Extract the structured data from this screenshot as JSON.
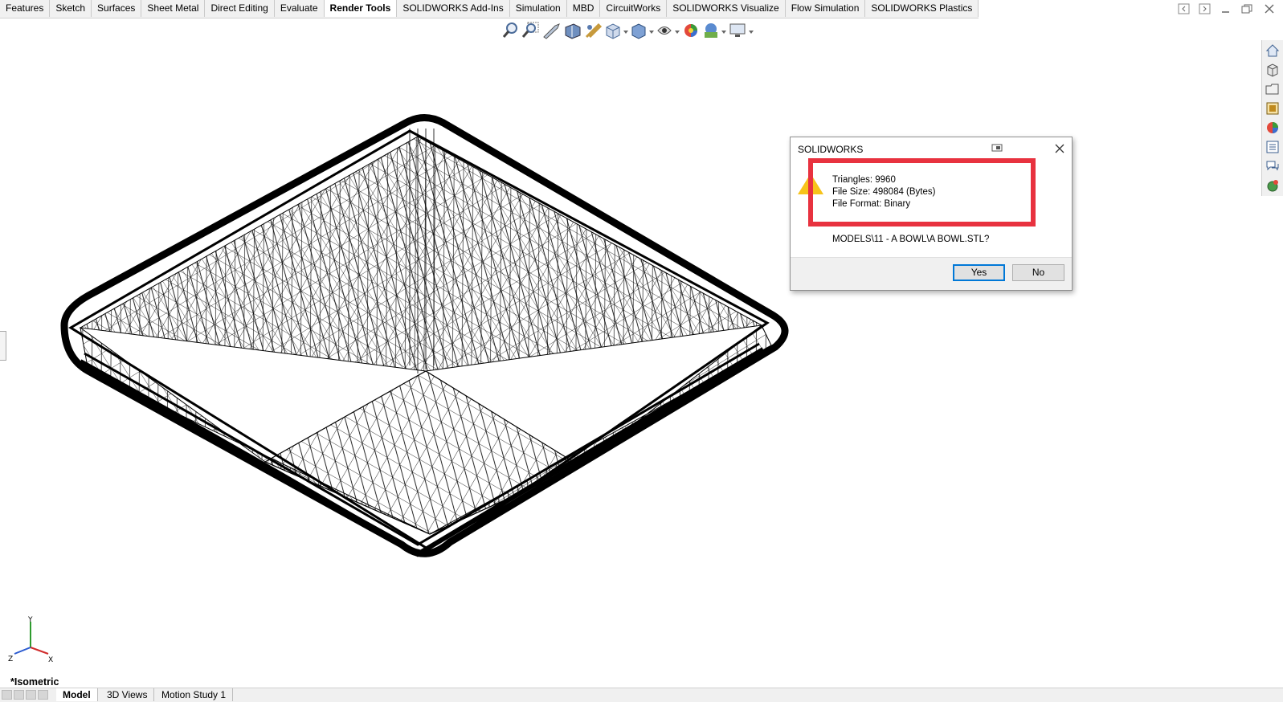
{
  "tabs": [
    "Features",
    "Sketch",
    "Surfaces",
    "Sheet Metal",
    "Direct Editing",
    "Evaluate",
    "Render Tools",
    "SOLIDWORKS Add-Ins",
    "Simulation",
    "MBD",
    "CircuitWorks",
    "SOLIDWORKS Visualize",
    "Flow Simulation",
    "SOLIDWORKS Plastics"
  ],
  "active_tab": "Render Tools",
  "hud_icons": [
    "zoom-to-fit-icon",
    "zoom-to-area-icon",
    "previous-view-icon",
    "section-view-icon",
    "dynamic-annotation-icon",
    "view-orientation-icon",
    "display-style-icon",
    "hide-show-items-icon",
    "edit-appearance-icon",
    "apply-scene-icon",
    "view-settings-icon"
  ],
  "taskpane_icons": [
    "home-icon",
    "design-library-icon",
    "file-explorer-icon",
    "view-palette-icon",
    "appearances-icon",
    "custom-properties-icon",
    "forum-icon",
    "resources-icon"
  ],
  "dialog": {
    "title": "SOLIDWORKS",
    "triangles": "Triangles: 9960",
    "file_size": "File Size: 498084 (Bytes)",
    "file_format": "File Format: Binary",
    "path_text": "MODELS\\11 - A BOWL\\A BOWL.STL?",
    "yes_label": "Yes",
    "no_label": "No"
  },
  "view_name": "*Isometric",
  "triad": {
    "x_label": "X",
    "y_label": "Y",
    "z_label": "Z"
  },
  "bottom_tabs": [
    "Model",
    "3D Views",
    "Motion Study 1"
  ],
  "active_bottom_tab": "Model",
  "colors": {
    "highlight": "#e8323f",
    "default_button_border": "#0078d7",
    "warning": "#f7c31a"
  }
}
